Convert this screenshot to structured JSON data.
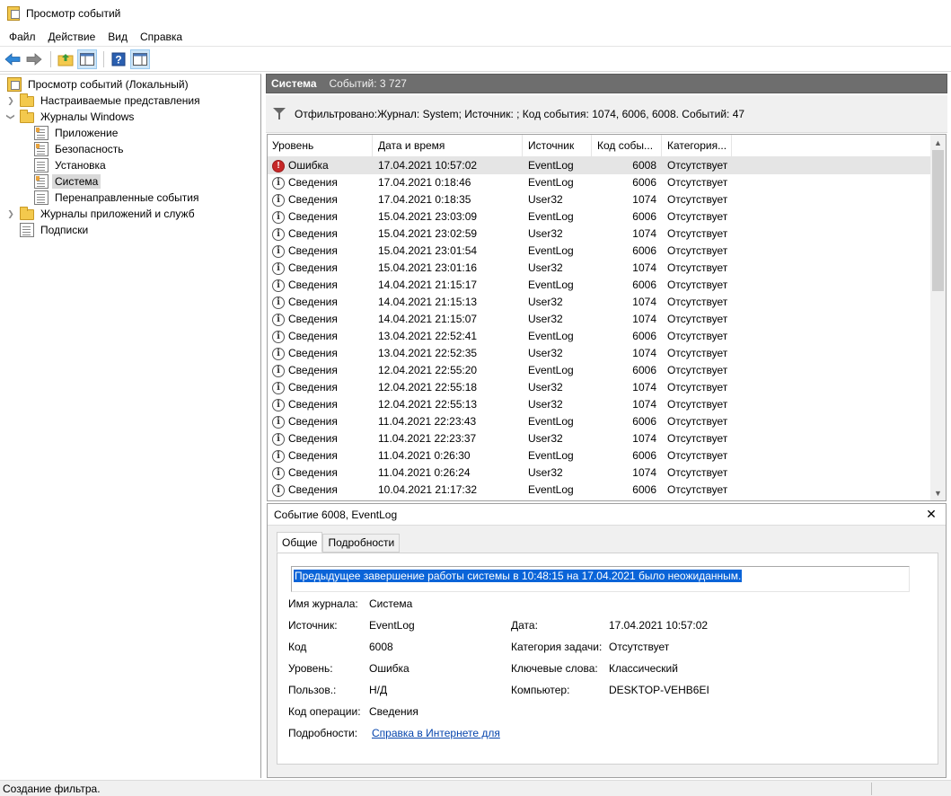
{
  "window": {
    "title": "Просмотр событий"
  },
  "menu": [
    "Файл",
    "Действие",
    "Вид",
    "Справка"
  ],
  "tree": [
    {
      "label": "Просмотр событий (Локальный)",
      "level": 0,
      "icon": "event-viewer-icon",
      "expander": "none"
    },
    {
      "label": "Настраиваемые представления",
      "level": 1,
      "icon": "folder-icon",
      "expander": "collapsed"
    },
    {
      "label": "Журналы Windows",
      "level": 1,
      "icon": "windows-logs-icon",
      "expander": "expanded"
    },
    {
      "label": "Приложение",
      "level": 2,
      "icon": "log-icon",
      "expander": "none"
    },
    {
      "label": "Безопасность",
      "level": 2,
      "icon": "log-icon",
      "expander": "none"
    },
    {
      "label": "Установка",
      "level": 2,
      "icon": "log-icon",
      "expander": "none"
    },
    {
      "label": "Система",
      "level": 2,
      "icon": "log-icon",
      "expander": "none",
      "selected": true
    },
    {
      "label": "Перенаправленные события",
      "level": 2,
      "icon": "log-icon",
      "expander": "none"
    },
    {
      "label": "Журналы приложений и служб",
      "level": 1,
      "icon": "folder-icon",
      "expander": "collapsed"
    },
    {
      "label": "Подписки",
      "level": 1,
      "icon": "subscriptions-icon",
      "expander": "none"
    }
  ],
  "panel": {
    "name": "Система",
    "count": "Событий: 3 727",
    "filter_text": "Отфильтровано:Журнал: System; Источник: ; Код события: 1074, 6006, 6008. Событий: 47"
  },
  "columns": [
    "Уровень",
    "Дата и время",
    "Источник",
    "Код собы...",
    "Категория..."
  ],
  "events": [
    {
      "level": "Ошибка",
      "type": "error",
      "date": "17.04.2021 10:57:02",
      "source": "EventLog",
      "code": "6008",
      "category": "Отсутствует",
      "selected": true
    },
    {
      "level": "Сведения",
      "type": "info",
      "date": "17.04.2021 0:18:46",
      "source": "EventLog",
      "code": "6006",
      "category": "Отсутствует"
    },
    {
      "level": "Сведения",
      "type": "info",
      "date": "17.04.2021 0:18:35",
      "source": "User32",
      "code": "1074",
      "category": "Отсутствует"
    },
    {
      "level": "Сведения",
      "type": "info",
      "date": "15.04.2021 23:03:09",
      "source": "EventLog",
      "code": "6006",
      "category": "Отсутствует"
    },
    {
      "level": "Сведения",
      "type": "info",
      "date": "15.04.2021 23:02:59",
      "source": "User32",
      "code": "1074",
      "category": "Отсутствует"
    },
    {
      "level": "Сведения",
      "type": "info",
      "date": "15.04.2021 23:01:54",
      "source": "EventLog",
      "code": "6006",
      "category": "Отсутствует"
    },
    {
      "level": "Сведения",
      "type": "info",
      "date": "15.04.2021 23:01:16",
      "source": "User32",
      "code": "1074",
      "category": "Отсутствует"
    },
    {
      "level": "Сведения",
      "type": "info",
      "date": "14.04.2021 21:15:17",
      "source": "EventLog",
      "code": "6006",
      "category": "Отсутствует"
    },
    {
      "level": "Сведения",
      "type": "info",
      "date": "14.04.2021 21:15:13",
      "source": "User32",
      "code": "1074",
      "category": "Отсутствует"
    },
    {
      "level": "Сведения",
      "type": "info",
      "date": "14.04.2021 21:15:07",
      "source": "User32",
      "code": "1074",
      "category": "Отсутствует"
    },
    {
      "level": "Сведения",
      "type": "info",
      "date": "13.04.2021 22:52:41",
      "source": "EventLog",
      "code": "6006",
      "category": "Отсутствует"
    },
    {
      "level": "Сведения",
      "type": "info",
      "date": "13.04.2021 22:52:35",
      "source": "User32",
      "code": "1074",
      "category": "Отсутствует"
    },
    {
      "level": "Сведения",
      "type": "info",
      "date": "12.04.2021 22:55:20",
      "source": "EventLog",
      "code": "6006",
      "category": "Отсутствует"
    },
    {
      "level": "Сведения",
      "type": "info",
      "date": "12.04.2021 22:55:18",
      "source": "User32",
      "code": "1074",
      "category": "Отсутствует"
    },
    {
      "level": "Сведения",
      "type": "info",
      "date": "12.04.2021 22:55:13",
      "source": "User32",
      "code": "1074",
      "category": "Отсутствует"
    },
    {
      "level": "Сведения",
      "type": "info",
      "date": "11.04.2021 22:23:43",
      "source": "EventLog",
      "code": "6006",
      "category": "Отсутствует"
    },
    {
      "level": "Сведения",
      "type": "info",
      "date": "11.04.2021 22:23:37",
      "source": "User32",
      "code": "1074",
      "category": "Отсутствует"
    },
    {
      "level": "Сведения",
      "type": "info",
      "date": "11.04.2021 0:26:30",
      "source": "EventLog",
      "code": "6006",
      "category": "Отсутствует"
    },
    {
      "level": "Сведения",
      "type": "info",
      "date": "11.04.2021 0:26:24",
      "source": "User32",
      "code": "1074",
      "category": "Отсутствует"
    },
    {
      "level": "Сведения",
      "type": "info",
      "date": "10.04.2021 21:17:32",
      "source": "EventLog",
      "code": "6006",
      "category": "Отсутствует"
    }
  ],
  "detail": {
    "title": "Событие 6008, EventLog",
    "close_glyph": "✕",
    "tabs": [
      "Общие",
      "Подробности"
    ],
    "description": "Предыдущее завершение работы системы в 10:48:15 на 17.04.2021 было неожиданным.",
    "fields_left": [
      {
        "label": "Имя журнала:",
        "value": "Система"
      },
      {
        "label": "Источник:",
        "value": "EventLog"
      },
      {
        "label": "Код",
        "value": "6008"
      },
      {
        "label": "Уровень:",
        "value": "Ошибка"
      },
      {
        "label": "Пользов.:",
        "value": "Н/Д"
      },
      {
        "label": "Код операции:",
        "value": "Сведения"
      },
      {
        "label": "Подробности:",
        "value": "Справка в Интернете для",
        "link": true
      }
    ],
    "fields_right": [
      {
        "label": "Дата:",
        "value": "17.04.2021 10:57:02"
      },
      {
        "label": "Категория задачи:",
        "value": "Отсутствует"
      },
      {
        "label": "Ключевые слова:",
        "value": "Классический"
      },
      {
        "label": "Компьютер:",
        "value": "DESKTOP-VEHB6EI"
      }
    ]
  },
  "status": {
    "text": "Создание фильтра."
  }
}
